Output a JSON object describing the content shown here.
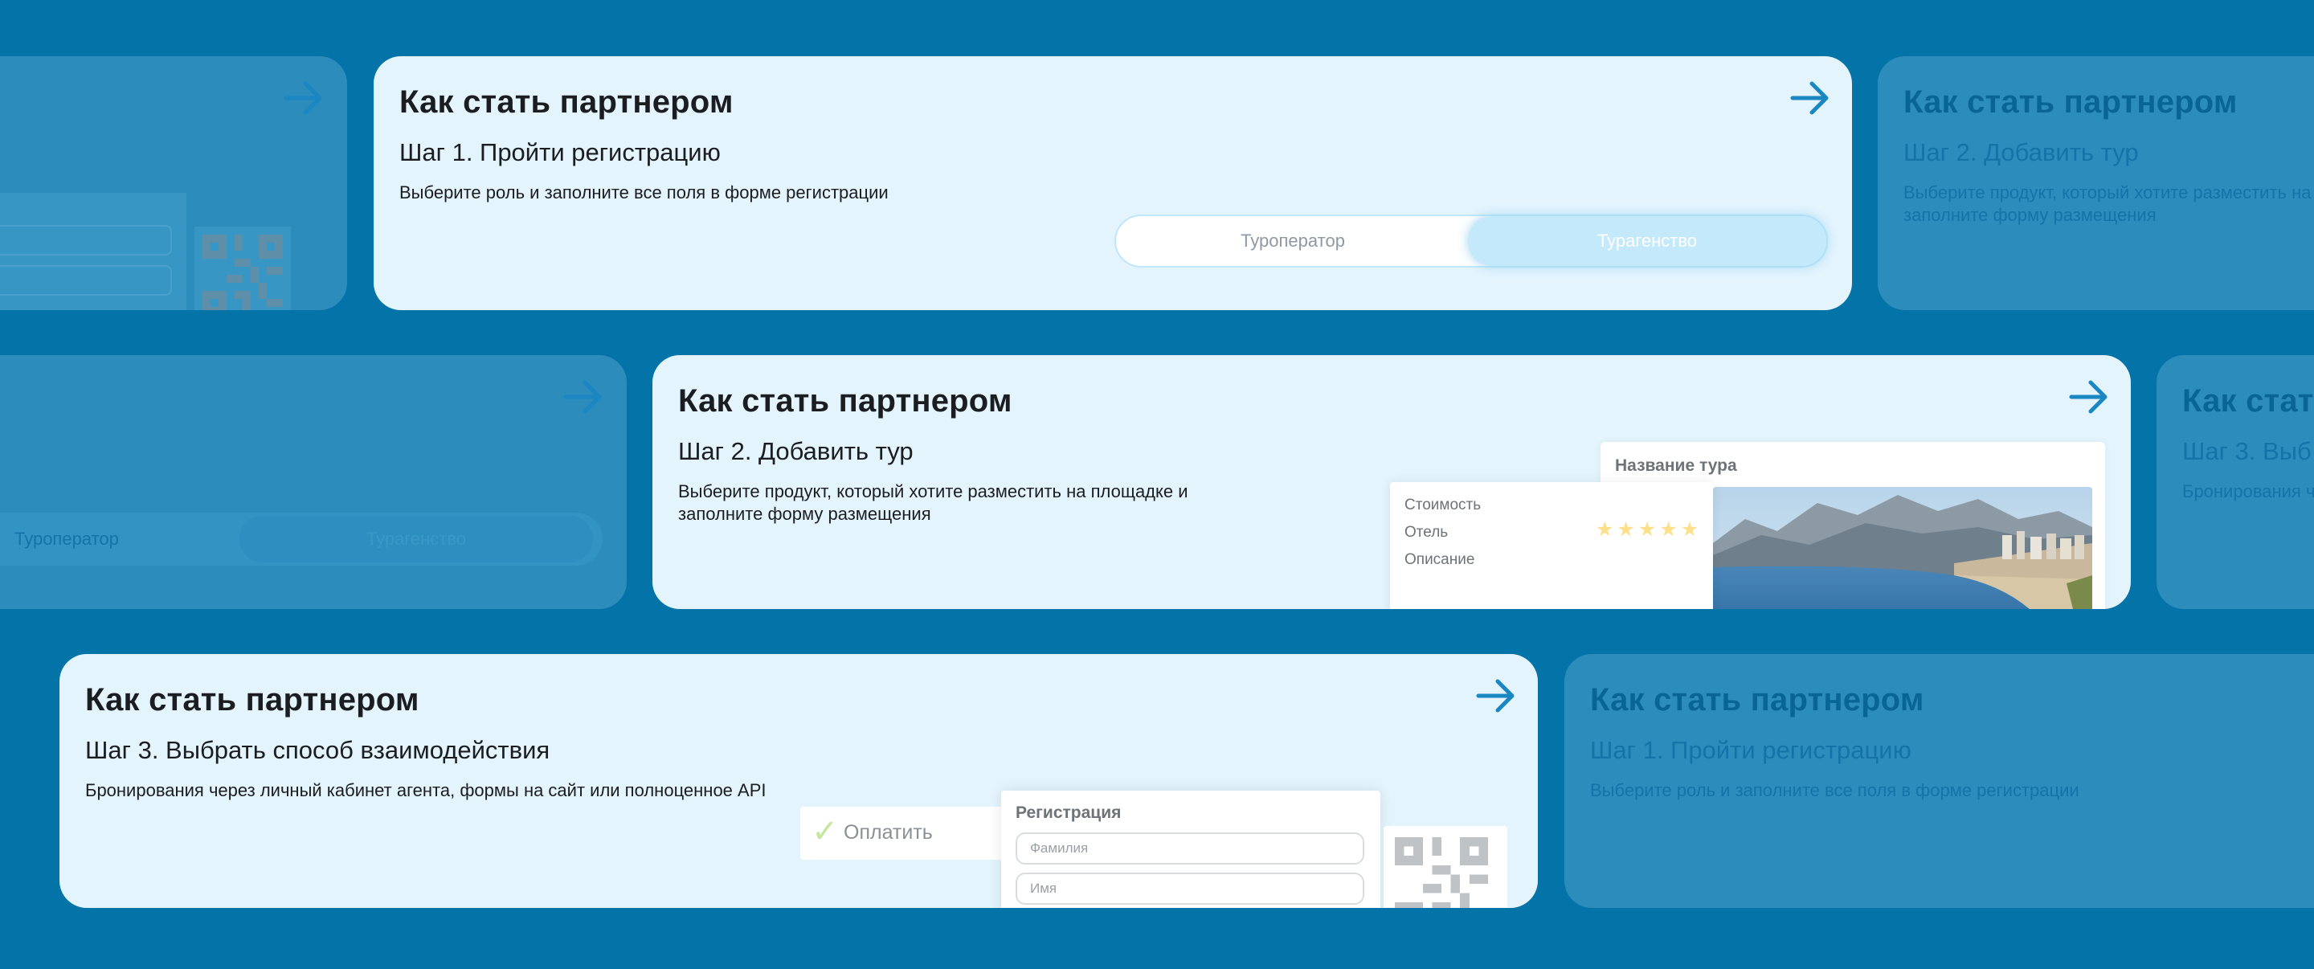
{
  "cards": {
    "title": "Как стать партнером",
    "step1": {
      "step": "Шаг 1. Пройти регистрацию",
      "desc": "Выберите роль и заполните все поля в форме регистрации",
      "toggle": {
        "option1": "Туроператор",
        "option2": "Турагенство"
      }
    },
    "step2": {
      "step": "Шаг 2.  Добавить тур",
      "desc_line1": "Выберите продукт, который хотите разместить на площадке и",
      "desc_line2": "заполните форму размещения",
      "form": {
        "title": "Название тура",
        "price_label": "Стоимость",
        "hotel_label": "Отель",
        "description_label": "Описание",
        "stars": "★★★★★",
        "stars_value": 5
      }
    },
    "step3": {
      "step": "Шаг 3. Выбрать способ взаимодействия",
      "step_truncated": "Шаг 3. Выб",
      "title_truncated": "Как стат",
      "desc": "Бронирования через личный кабинет агента, формы на сайт или полноценное API",
      "desc_truncated": "Бронирования ч",
      "pay": {
        "check": "✓",
        "label": "Оплатить"
      },
      "registration": {
        "title": "Регистрация",
        "lastname_placeholder": "Фамилия",
        "firstname_placeholder": "Имя"
      }
    },
    "step2_faded": {
      "step": "Шаг 2.  Добавить тур",
      "desc_line1": "Выберите продукт, который хотите разместить на площадке и",
      "desc_line2": "заполните форму размещения"
    }
  },
  "colors": {
    "background": "#0373a8",
    "card_active": "#e3f4fd",
    "card_faded": "#2c8cbc",
    "accent": "#1a86c2"
  }
}
